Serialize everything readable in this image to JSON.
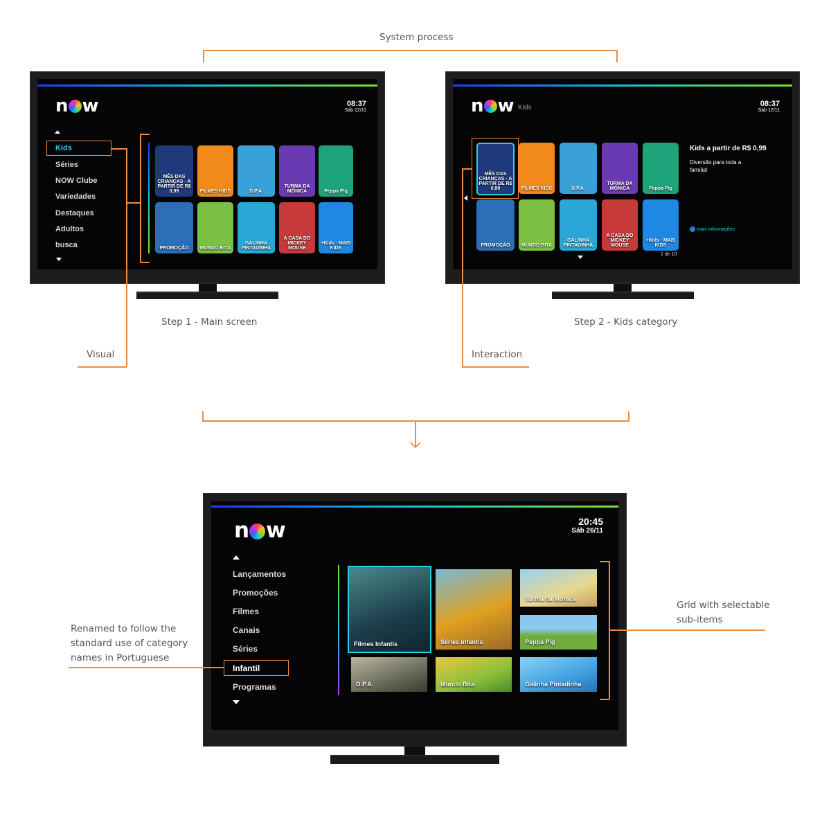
{
  "annotations": {
    "system_process": "System process",
    "step1": "Step 1 - Main screen",
    "step2": "Step 2 - Kids category",
    "visual": "Visual",
    "interaction": "Interaction",
    "renamed_line1": "Renamed to follow the",
    "renamed_line2": "standard use of category",
    "renamed_line3": "names in Portuguese",
    "grid_line1": "Grid with selectable",
    "grid_line2": "sub-items"
  },
  "tv1": {
    "logo_n": "n",
    "logo_w": "w",
    "time": "08:37",
    "date": "Sáb 12/11",
    "menu": [
      "Kids",
      "Séries",
      "NOW Clube",
      "Variedades",
      "Destaques",
      "Adultos",
      "busca"
    ],
    "tiles": [
      {
        "label": "MÊS DAS CRIANÇAS · A PARTIR DE R$ 0,99",
        "color": "#1f3a7a"
      },
      {
        "label": "FILMES KIDS",
        "color": "#f28a1b"
      },
      {
        "label": "D.P.A.",
        "color": "#3aa0d8"
      },
      {
        "label": "TURMA DA MÔNICA",
        "color": "#6a3ab2"
      },
      {
        "label": "Peppa Pig",
        "color": "#1fa37a"
      },
      {
        "label": "PROMOÇÃO",
        "color": "#2a6fb8"
      },
      {
        "label": "MUNDO BITA",
        "color": "#7bc043"
      },
      {
        "label": "GALINHA PINTADINHA",
        "color": "#2aa7d6"
      },
      {
        "label": "A CASA DO MICKEY MOUSE",
        "color": "#c73a3a"
      },
      {
        "label": "+Kids · MAIS KIDS",
        "color": "#1e88e5"
      }
    ]
  },
  "tv2": {
    "logo_n": "n",
    "logo_w": "w",
    "section": "Kids",
    "time": "08:37",
    "date": "Sáb 12/11",
    "info_title": "Kids a partir de R$ 0,99",
    "info_desc_line1": "Diversão para toda a",
    "info_desc_line2": "família!",
    "more_info": "mais informações",
    "pager": "1 de 10"
  },
  "tv3": {
    "logo_n": "n",
    "logo_w": "w",
    "time": "20:45",
    "date": "Sáb 26/11",
    "menu": [
      "Lançamentos",
      "Promoções",
      "Filmes",
      "Canais",
      "Séries",
      "Infantil",
      "Programas"
    ],
    "grid": [
      {
        "label": "Filmes Infantis",
        "color": "#2b5c6a"
      },
      {
        "label": "Séries infantis",
        "color": "#e0a020"
      },
      {
        "label": "Turma da Mônica",
        "color": "#7ab8e8"
      },
      {
        "label": "Peppa Pig",
        "color": "#6fae3e"
      },
      {
        "label": "D.P.A.",
        "color": "#6a6a5a"
      },
      {
        "label": "Mundo Bita",
        "color": "#8cbf3a"
      },
      {
        "label": "Galinha Pintadinha",
        "color": "#3fa2e0"
      }
    ]
  },
  "colors": {
    "accent": "#f08a3c",
    "selection": "#2ad1e0",
    "menu_active": "#2ad1e0"
  }
}
